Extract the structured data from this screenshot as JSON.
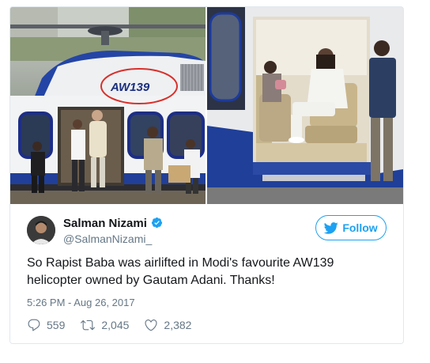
{
  "media": {
    "left_photo": {
      "tail_marking": "AW139"
    }
  },
  "tweet": {
    "author_name": "Salman Nizami",
    "handle": "@SalmanNizami_",
    "follow_label": "Follow",
    "text": "So Rapist Baba was airlifted in Modi's favourite AW139 helicopter owned by Gautam Adani. Thanks!",
    "timestamp": "5:26 PM - Aug 26, 2017",
    "replies": "559",
    "retweets": "2,045",
    "likes": "2,382"
  },
  "icons": {
    "verified": "verified-badge-icon",
    "follow_bird": "twitter-bird-icon",
    "reply": "reply-icon",
    "retweet": "retweet-icon",
    "like": "heart-icon"
  },
  "colors": {
    "twitter_blue": "#1da1f2",
    "text_primary": "#14171a",
    "text_secondary": "#657786",
    "card_border": "#e1e8ed",
    "annotation_red": "#d9302b"
  }
}
